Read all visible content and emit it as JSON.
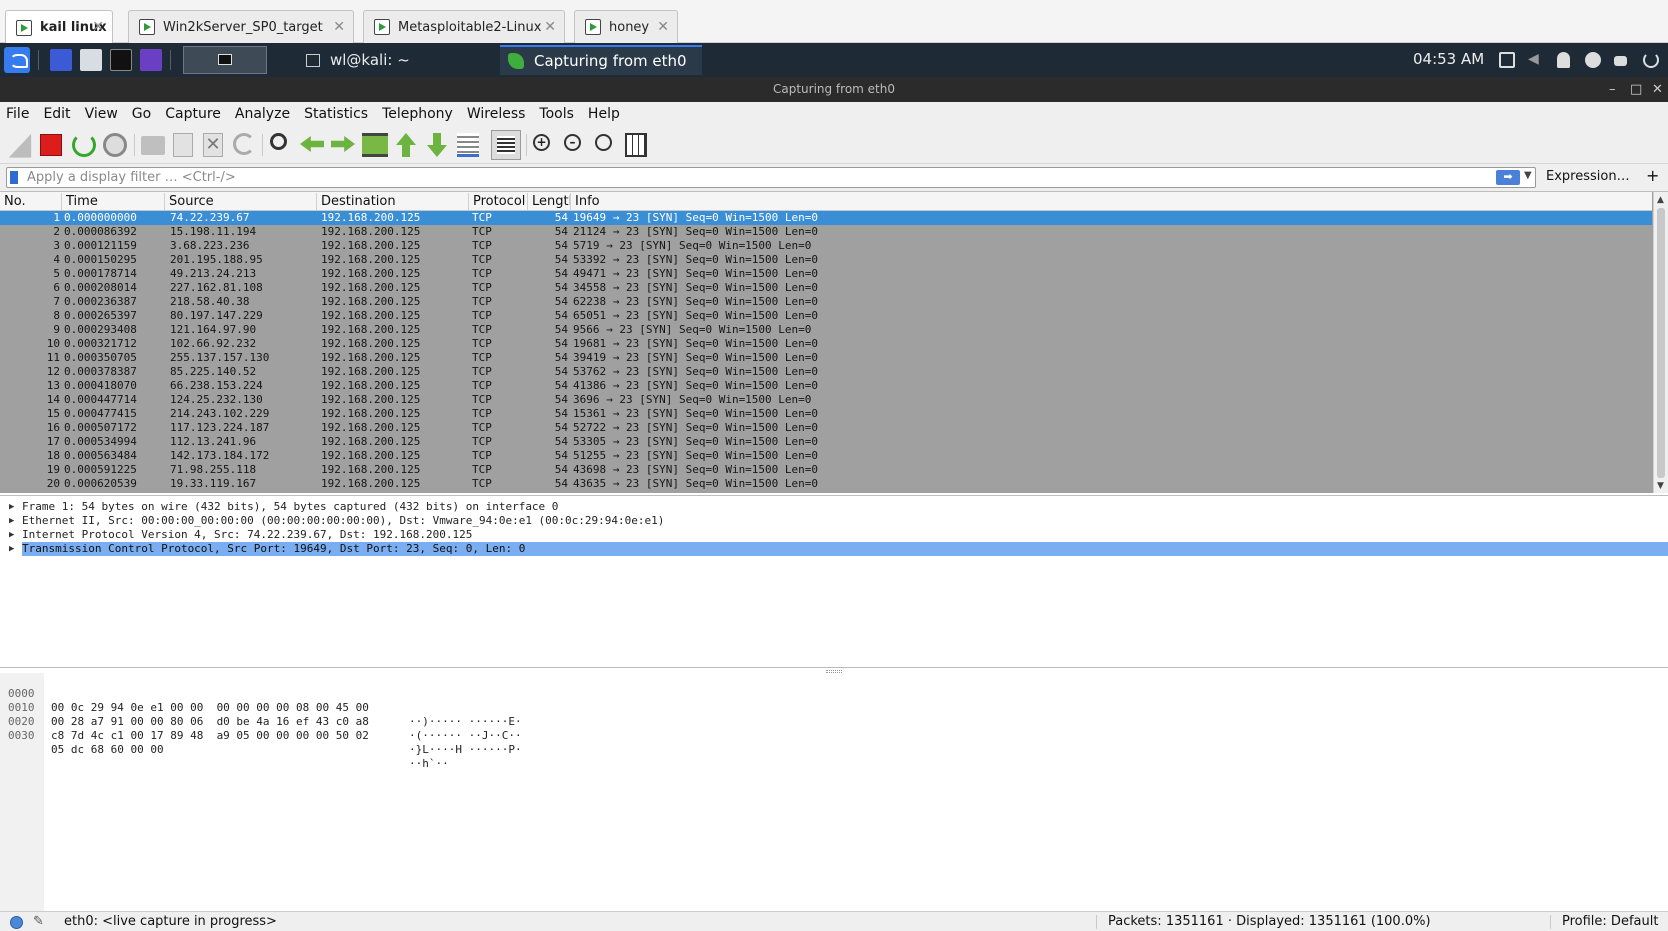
{
  "vm_tabs": [
    {
      "label": "kail linux",
      "active": true
    },
    {
      "label": "Win2kServer_SP0_target",
      "active": false
    },
    {
      "label": "Metasploitable2-Linux",
      "active": false
    },
    {
      "label": "honey",
      "active": false
    }
  ],
  "panel": {
    "task_terminal": "wl@kali: ~",
    "task_capture": "Capturing from eth0",
    "clock": "04:53 AM"
  },
  "window": {
    "title": "Capturing from eth0"
  },
  "menu": [
    "File",
    "Edit",
    "View",
    "Go",
    "Capture",
    "Analyze",
    "Statistics",
    "Telephony",
    "Wireless",
    "Tools",
    "Help"
  ],
  "filter": {
    "placeholder": "Apply a display filter … <Ctrl-/>",
    "expression_label": "Expression…",
    "add_label": "+"
  },
  "columns": [
    "No.",
    "Time",
    "Source",
    "Destination",
    "Protocol",
    "Length",
    "Info"
  ],
  "packets": [
    {
      "no": "1",
      "time": "0.000000000",
      "src": "74.22.239.67",
      "dst": "192.168.200.125",
      "proto": "TCP",
      "len": "54",
      "info": "19649 → 23 [SYN] Seq=0 Win=1500 Len=0",
      "selected": true
    },
    {
      "no": "2",
      "time": "0.000086392",
      "src": "15.198.11.194",
      "dst": "192.168.200.125",
      "proto": "TCP",
      "len": "54",
      "info": "21124 → 23 [SYN] Seq=0 Win=1500 Len=0"
    },
    {
      "no": "3",
      "time": "0.000121159",
      "src": "3.68.223.236",
      "dst": "192.168.200.125",
      "proto": "TCP",
      "len": "54",
      "info": "5719 → 23 [SYN] Seq=0 Win=1500 Len=0"
    },
    {
      "no": "4",
      "time": "0.000150295",
      "src": "201.195.188.95",
      "dst": "192.168.200.125",
      "proto": "TCP",
      "len": "54",
      "info": "53392 → 23 [SYN] Seq=0 Win=1500 Len=0"
    },
    {
      "no": "5",
      "time": "0.000178714",
      "src": "49.213.24.213",
      "dst": "192.168.200.125",
      "proto": "TCP",
      "len": "54",
      "info": "49471 → 23 [SYN] Seq=0 Win=1500 Len=0"
    },
    {
      "no": "6",
      "time": "0.000208014",
      "src": "227.162.81.108",
      "dst": "192.168.200.125",
      "proto": "TCP",
      "len": "54",
      "info": "34558 → 23 [SYN] Seq=0 Win=1500 Len=0"
    },
    {
      "no": "7",
      "time": "0.000236387",
      "src": "218.58.40.38",
      "dst": "192.168.200.125",
      "proto": "TCP",
      "len": "54",
      "info": "62238 → 23 [SYN] Seq=0 Win=1500 Len=0"
    },
    {
      "no": "8",
      "time": "0.000265397",
      "src": "80.197.147.229",
      "dst": "192.168.200.125",
      "proto": "TCP",
      "len": "54",
      "info": "65051 → 23 [SYN] Seq=0 Win=1500 Len=0"
    },
    {
      "no": "9",
      "time": "0.000293408",
      "src": "121.164.97.90",
      "dst": "192.168.200.125",
      "proto": "TCP",
      "len": "54",
      "info": "9566 → 23 [SYN] Seq=0 Win=1500 Len=0"
    },
    {
      "no": "10",
      "time": "0.000321712",
      "src": "102.66.92.232",
      "dst": "192.168.200.125",
      "proto": "TCP",
      "len": "54",
      "info": "19681 → 23 [SYN] Seq=0 Win=1500 Len=0"
    },
    {
      "no": "11",
      "time": "0.000350705",
      "src": "255.137.157.130",
      "dst": "192.168.200.125",
      "proto": "TCP",
      "len": "54",
      "info": "39419 → 23 [SYN] Seq=0 Win=1500 Len=0"
    },
    {
      "no": "12",
      "time": "0.000378387",
      "src": "85.225.140.52",
      "dst": "192.168.200.125",
      "proto": "TCP",
      "len": "54",
      "info": "53762 → 23 [SYN] Seq=0 Win=1500 Len=0"
    },
    {
      "no": "13",
      "time": "0.000418070",
      "src": "66.238.153.224",
      "dst": "192.168.200.125",
      "proto": "TCP",
      "len": "54",
      "info": "41386 → 23 [SYN] Seq=0 Win=1500 Len=0"
    },
    {
      "no": "14",
      "time": "0.000447714",
      "src": "124.25.232.130",
      "dst": "192.168.200.125",
      "proto": "TCP",
      "len": "54",
      "info": "3696 → 23 [SYN] Seq=0 Win=1500 Len=0"
    },
    {
      "no": "15",
      "time": "0.000477415",
      "src": "214.243.102.229",
      "dst": "192.168.200.125",
      "proto": "TCP",
      "len": "54",
      "info": "15361 → 23 [SYN] Seq=0 Win=1500 Len=0"
    },
    {
      "no": "16",
      "time": "0.000507172",
      "src": "117.123.224.187",
      "dst": "192.168.200.125",
      "proto": "TCP",
      "len": "54",
      "info": "52722 → 23 [SYN] Seq=0 Win=1500 Len=0"
    },
    {
      "no": "17",
      "time": "0.000534994",
      "src": "112.13.241.96",
      "dst": "192.168.200.125",
      "proto": "TCP",
      "len": "54",
      "info": "53305 → 23 [SYN] Seq=0 Win=1500 Len=0"
    },
    {
      "no": "18",
      "time": "0.000563484",
      "src": "142.173.184.172",
      "dst": "192.168.200.125",
      "proto": "TCP",
      "len": "54",
      "info": "51255 → 23 [SYN] Seq=0 Win=1500 Len=0"
    },
    {
      "no": "19",
      "time": "0.000591225",
      "src": "71.98.255.118",
      "dst": "192.168.200.125",
      "proto": "TCP",
      "len": "54",
      "info": "43698 → 23 [SYN] Seq=0 Win=1500 Len=0"
    },
    {
      "no": "20",
      "time": "0.000620539",
      "src": "19.33.119.167",
      "dst": "192.168.200.125",
      "proto": "TCP",
      "len": "54",
      "info": "43635 → 23 [SYN] Seq=0 Win=1500 Len=0"
    }
  ],
  "details": [
    {
      "text": "Frame 1: 54 bytes on wire (432 bits), 54 bytes captured (432 bits) on interface 0"
    },
    {
      "text": "Ethernet II, Src: 00:00:00_00:00:00 (00:00:00:00:00:00), Dst: Vmware_94:0e:e1 (00:0c:29:94:0e:e1)"
    },
    {
      "text": "Internet Protocol Version 4, Src: 74.22.239.67, Dst: 192.168.200.125"
    },
    {
      "text": "Transmission Control Protocol, Src Port: 19649, Dst Port: 23, Seq: 0, Len: 0",
      "selected": true
    }
  ],
  "bytes": [
    {
      "offset": "0000",
      "hex": "00 0c 29 94 0e e1 00 00  00 00 00 00 08 00 45 00",
      "ascii": "··)····· ······E·"
    },
    {
      "offset": "0010",
      "hex": "00 28 a7 91 00 00 80 06  d0 be 4a 16 ef 43 c0 a8",
      "ascii": "·(······ ··J··C··"
    },
    {
      "offset": "0020",
      "hex": "c8 7d 4c c1 00 17 89 48  a9 05 00 00 00 00 50 02",
      "ascii": "·}L····H ······P·"
    },
    {
      "offset": "0030",
      "hex": "05 dc 68 60 00 00",
      "ascii": "··h`··"
    }
  ],
  "status": {
    "interface": "eth0: <live capture in progress>",
    "packets": "Packets: 1351161 · Displayed: 1351161 (100.0%)",
    "profile": "Profile: Default"
  },
  "colors": {
    "selected_row": "#3a8ed6",
    "packet_bg": "#a0a0a0",
    "selected_detail": "#7aaef0",
    "panel_bg": "#1e2a36"
  }
}
